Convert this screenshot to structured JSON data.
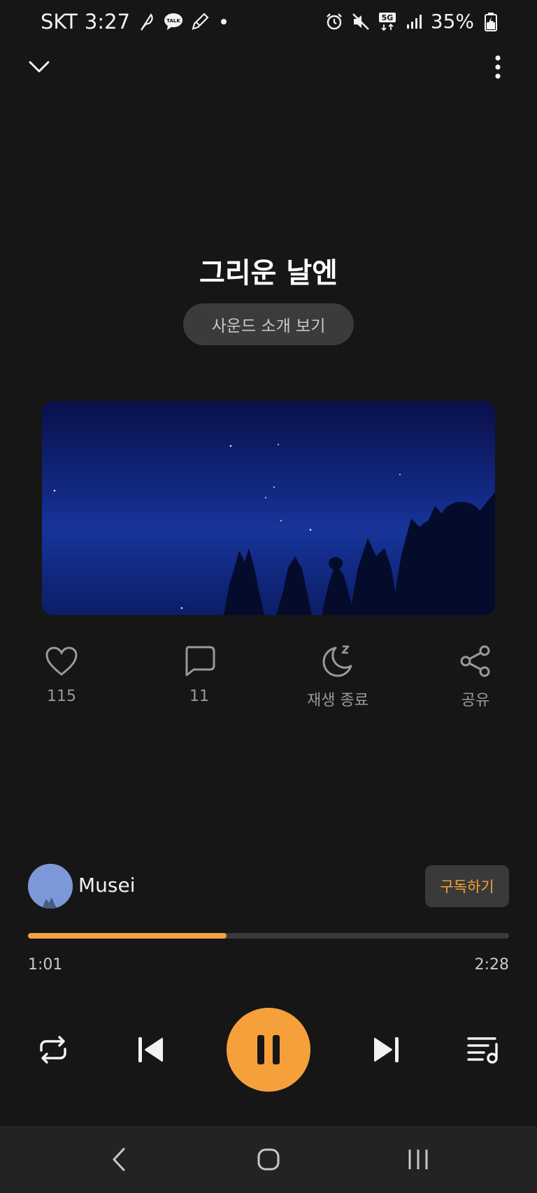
{
  "status_bar": {
    "carrier": "SKT",
    "time": "3:27",
    "notification_icons": [
      "feather-icon",
      "kakaotalk-icon",
      "pencil-icon"
    ],
    "kakaotalk_label": "TALK",
    "network": "5G",
    "battery": "35%"
  },
  "track": {
    "title": "그리운 날엔",
    "intro_button": "사운드 소개 보기"
  },
  "actions": {
    "like_count": "115",
    "comment_count": "11",
    "sleep_timer_label": "재생 종료",
    "share_label": "공유"
  },
  "artist": {
    "name": "Musei",
    "subscribe_label": "구독하기"
  },
  "playback": {
    "current_time": "1:01",
    "total_time": "2:28",
    "progress_fraction": 0.413,
    "state": "playing"
  },
  "colors": {
    "accent": "#f6a03b",
    "background": "#161616",
    "button_bg": "#3b3b3b"
  }
}
